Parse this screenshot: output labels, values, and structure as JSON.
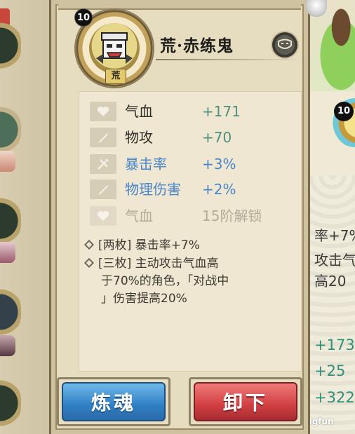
{
  "yuhun": {
    "level": "10",
    "name": "荒·赤练鬼",
    "rarity_tag": "荒"
  },
  "stats": [
    {
      "name": "气血",
      "value": "+171",
      "icon": "heart-icon",
      "style": "normal"
    },
    {
      "name": "物攻",
      "value": "+70",
      "icon": "sword-icon",
      "style": "normal"
    },
    {
      "name": "暴击率",
      "value": "+3%",
      "icon": "crit-icon",
      "style": "blue"
    },
    {
      "name": "物理伤害",
      "value": "+2%",
      "icon": "sword-icon",
      "style": "blue"
    },
    {
      "name": "气血",
      "value": "15阶解锁",
      "icon": "heart-icon",
      "style": "locked"
    }
  ],
  "set_effects": {
    "two_piece": "[两枚] 暴击率+7%",
    "three_piece_line1": "[三枚] 主动攻击气血高",
    "three_piece_line2": "于70%的角色，「对战中",
    "three_piece_line3": "」伤害提高20%"
  },
  "buttons": {
    "refine": "炼魂",
    "unequip": "卸下"
  },
  "background": {
    "right_level": "10",
    "right_text_1": "率+7%",
    "right_text_2": "攻击气",
    "right_text_3": "高20",
    "right_num_1": "+173",
    "right_num_2": "+25",
    "right_num_3": "+322",
    "watermark": "bigfun"
  },
  "colors": {
    "stat_value_green": "#4f8f7b",
    "stat_blue": "#4a86c9",
    "locked_gray": "#b4ab98",
    "refine_blue": "#2f7fc3",
    "unequip_red": "#d13f42"
  }
}
